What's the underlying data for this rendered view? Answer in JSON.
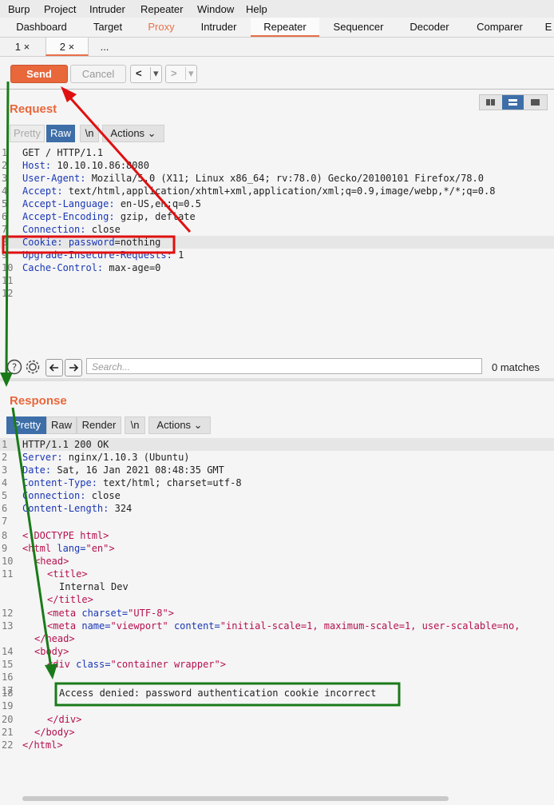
{
  "menu": [
    "Burp",
    "Project",
    "Intruder",
    "Repeater",
    "Window",
    "Help"
  ],
  "tabs": [
    "Dashboard",
    "Target",
    "Proxy",
    "Intruder",
    "Repeater",
    "Sequencer",
    "Decoder",
    "Comparer",
    "E"
  ],
  "subtabs": [
    "1 ×",
    "2 ×",
    "..."
  ],
  "toolbar": {
    "send": "Send",
    "cancel": "Cancel",
    "back": "<",
    "back_drop": "▾",
    "fwd": ">",
    "fwd_drop": "▾"
  },
  "request": {
    "title": "Request",
    "view_tabs": [
      "Pretty",
      "Raw",
      "\\n",
      "Actions ⌄"
    ],
    "lines": [
      {
        "n": "1",
        "k": "GET / HTTP/1.1",
        "v": ""
      },
      {
        "n": "2",
        "k": "Host:",
        "v": " 10.10.10.86:8080"
      },
      {
        "n": "3",
        "k": "User-Agent:",
        "v": " Mozilla/5.0 (X11; Linux x86_64; rv:78.0) Gecko/20100101 Firefox/78.0"
      },
      {
        "n": "4",
        "k": "Accept:",
        "v": " text/html,application/xhtml+xml,application/xml;q=0.9,image/webp,*/*;q=0.8"
      },
      {
        "n": "5",
        "k": "Accept-Language:",
        "v": " en-US,en;q=0.5"
      },
      {
        "n": "6",
        "k": "Accept-Encoding:",
        "v": " gzip, deflate"
      },
      {
        "n": "7",
        "k": "Connection:",
        "v": " close"
      },
      {
        "n": "8",
        "k": "Cookie:",
        "v": " password=nothing"
      },
      {
        "n": "9",
        "k": "Upgrade-Insecure-Requests:",
        "v": " 1"
      },
      {
        "n": "10",
        "k": "Cache-Control:",
        "v": " max-age=0"
      },
      {
        "n": "11",
        "k": "",
        "v": ""
      },
      {
        "n": "12",
        "k": "",
        "v": ""
      }
    ],
    "cookie_name": "password",
    "cookie_value": "=nothing"
  },
  "search": {
    "placeholder": "Search...",
    "matches": "0 matches"
  },
  "response": {
    "title": "Response",
    "view_tabs": [
      "Pretty",
      "Raw",
      "Render",
      "\\n",
      "Actions ⌄"
    ],
    "headers": [
      {
        "n": "1",
        "k": "HTTP/1.1 200 OK",
        "v": ""
      },
      {
        "n": "2",
        "k": "Server:",
        "v": " nginx/1.10.3 (Ubuntu)"
      },
      {
        "n": "3",
        "k": "Date:",
        "v": " Sat, 16 Jan 2021 08:48:35 GMT"
      },
      {
        "n": "4",
        "k": "Content-Type:",
        "v": " text/html; charset=utf-8"
      },
      {
        "n": "5",
        "k": "Connection:",
        "v": " close"
      },
      {
        "n": "6",
        "k": "Content-Length:",
        "v": " 324"
      },
      {
        "n": "7",
        "k": "",
        "v": ""
      }
    ],
    "body": {
      "l8": "<!DOCTYPE html>",
      "l9_tag": "<html",
      "l9_attr": " lang=",
      "l9_str": "\"en\"",
      "l9_end": ">",
      "l10": "<head>",
      "l11a": "<title>",
      "l11b": "Internal Dev",
      "l11c": "</title>",
      "l12_tag": "<meta",
      "l12_attr": " charset=",
      "l12_str": "\"UTF-8\"",
      "l12_end": ">",
      "l13_tag": "<meta",
      "l13_attr": " name=",
      "l13_str": "\"viewport\"",
      "l13_attr2": " content=",
      "l13_str2": "\"initial-scale=1, maximum-scale=1, user-scalable=no,",
      "l14": "</head>",
      "l15": "<body>",
      "l16_tag": "<div",
      "l16_attr": " class=",
      "l16_str": "\"container wrapper\"",
      "l16_end": ">",
      "l18": "Access denied: password authentication cookie incorrect",
      "l20": "</div>",
      "l21": "</body>",
      "l22": "</html>",
      "n17": "17",
      "n18": "18",
      "n19": "19",
      "n20": "20",
      "n21": "21",
      "n22": "22",
      "nb8": "8",
      "nb9": "9",
      "nb10": "10",
      "nb11": "11",
      "nb12": "12",
      "nb13": "13",
      "nb14": "",
      "nb15": "14",
      "nb16": "15",
      "nb16b": "16"
    }
  },
  "colors": {
    "accent": "#e8673b",
    "active_blue": "#3d6ea8",
    "annot_red": "#e01010",
    "annot_green": "#1a7a1a"
  }
}
